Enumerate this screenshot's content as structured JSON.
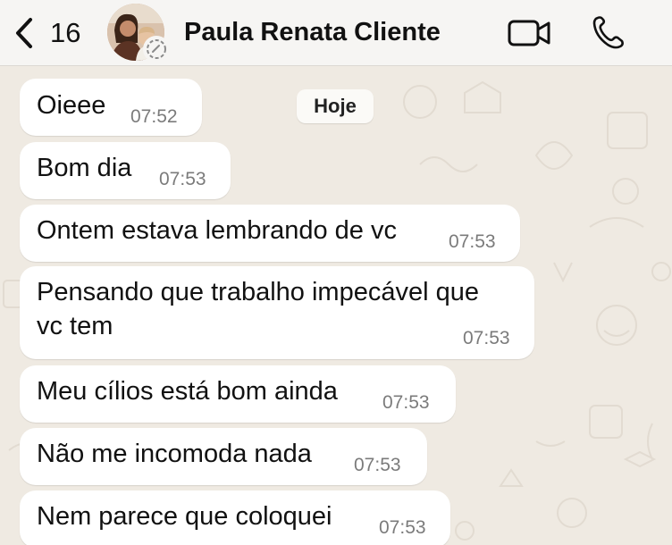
{
  "header": {
    "unread_count": "16",
    "contact_name": "Paula Renata Cliente"
  },
  "chat": {
    "date_label": "Hoje",
    "messages": [
      {
        "text": "Oieee",
        "time": "07:52"
      },
      {
        "text": "Bom dia",
        "time": "07:53"
      },
      {
        "text": "Ontem estava lembrando de vc",
        "time": "07:53"
      },
      {
        "text": "Pensando que trabalho impecável que",
        "text2": "vc tem",
        "time": "07:53"
      },
      {
        "text": "Meu cílios está bom ainda",
        "time": "07:53"
      },
      {
        "text": "Não me incomoda nada",
        "time": "07:53"
      },
      {
        "text": "Nem parece que coloquei",
        "time": "07:53"
      }
    ]
  },
  "colors": {
    "wallpaper": "#efeae2",
    "bubble": "#ffffff",
    "header": "#f6f5f3"
  },
  "icons": [
    "chevron-left-icon",
    "video-call-icon",
    "phone-icon",
    "status-icon"
  ]
}
